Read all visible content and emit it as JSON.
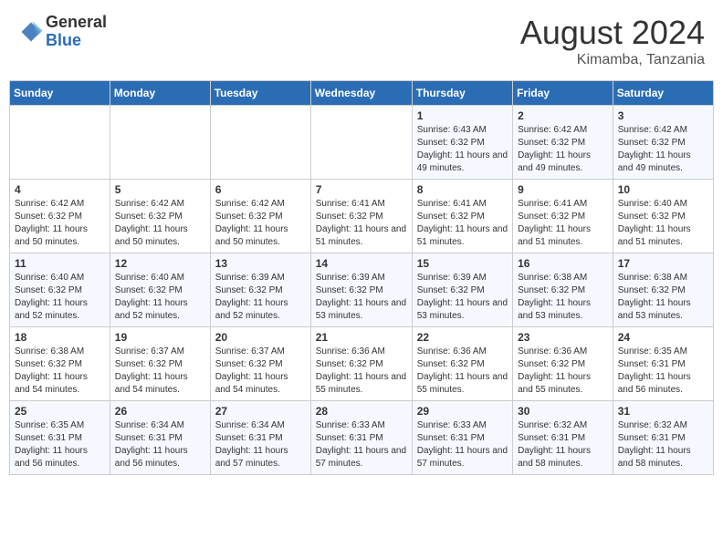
{
  "header": {
    "logo_general": "General",
    "logo_blue": "Blue",
    "month_title": "August 2024",
    "location": "Kimamba, Tanzania"
  },
  "weekdays": [
    "Sunday",
    "Monday",
    "Tuesday",
    "Wednesday",
    "Thursday",
    "Friday",
    "Saturday"
  ],
  "weeks": [
    [
      {
        "day": "",
        "detail": ""
      },
      {
        "day": "",
        "detail": ""
      },
      {
        "day": "",
        "detail": ""
      },
      {
        "day": "",
        "detail": ""
      },
      {
        "day": "1",
        "detail": "Sunrise: 6:43 AM\nSunset: 6:32 PM\nDaylight: 11 hours\nand 49 minutes."
      },
      {
        "day": "2",
        "detail": "Sunrise: 6:42 AM\nSunset: 6:32 PM\nDaylight: 11 hours\nand 49 minutes."
      },
      {
        "day": "3",
        "detail": "Sunrise: 6:42 AM\nSunset: 6:32 PM\nDaylight: 11 hours\nand 49 minutes."
      }
    ],
    [
      {
        "day": "4",
        "detail": "Sunrise: 6:42 AM\nSunset: 6:32 PM\nDaylight: 11 hours\nand 50 minutes."
      },
      {
        "day": "5",
        "detail": "Sunrise: 6:42 AM\nSunset: 6:32 PM\nDaylight: 11 hours\nand 50 minutes."
      },
      {
        "day": "6",
        "detail": "Sunrise: 6:42 AM\nSunset: 6:32 PM\nDaylight: 11 hours\nand 50 minutes."
      },
      {
        "day": "7",
        "detail": "Sunrise: 6:41 AM\nSunset: 6:32 PM\nDaylight: 11 hours\nand 51 minutes."
      },
      {
        "day": "8",
        "detail": "Sunrise: 6:41 AM\nSunset: 6:32 PM\nDaylight: 11 hours\nand 51 minutes."
      },
      {
        "day": "9",
        "detail": "Sunrise: 6:41 AM\nSunset: 6:32 PM\nDaylight: 11 hours\nand 51 minutes."
      },
      {
        "day": "10",
        "detail": "Sunrise: 6:40 AM\nSunset: 6:32 PM\nDaylight: 11 hours\nand 51 minutes."
      }
    ],
    [
      {
        "day": "11",
        "detail": "Sunrise: 6:40 AM\nSunset: 6:32 PM\nDaylight: 11 hours\nand 52 minutes."
      },
      {
        "day": "12",
        "detail": "Sunrise: 6:40 AM\nSunset: 6:32 PM\nDaylight: 11 hours\nand 52 minutes."
      },
      {
        "day": "13",
        "detail": "Sunrise: 6:39 AM\nSunset: 6:32 PM\nDaylight: 11 hours\nand 52 minutes."
      },
      {
        "day": "14",
        "detail": "Sunrise: 6:39 AM\nSunset: 6:32 PM\nDaylight: 11 hours\nand 53 minutes."
      },
      {
        "day": "15",
        "detail": "Sunrise: 6:39 AM\nSunset: 6:32 PM\nDaylight: 11 hours\nand 53 minutes."
      },
      {
        "day": "16",
        "detail": "Sunrise: 6:38 AM\nSunset: 6:32 PM\nDaylight: 11 hours\nand 53 minutes."
      },
      {
        "day": "17",
        "detail": "Sunrise: 6:38 AM\nSunset: 6:32 PM\nDaylight: 11 hours\nand 53 minutes."
      }
    ],
    [
      {
        "day": "18",
        "detail": "Sunrise: 6:38 AM\nSunset: 6:32 PM\nDaylight: 11 hours\nand 54 minutes."
      },
      {
        "day": "19",
        "detail": "Sunrise: 6:37 AM\nSunset: 6:32 PM\nDaylight: 11 hours\nand 54 minutes."
      },
      {
        "day": "20",
        "detail": "Sunrise: 6:37 AM\nSunset: 6:32 PM\nDaylight: 11 hours\nand 54 minutes."
      },
      {
        "day": "21",
        "detail": "Sunrise: 6:36 AM\nSunset: 6:32 PM\nDaylight: 11 hours\nand 55 minutes."
      },
      {
        "day": "22",
        "detail": "Sunrise: 6:36 AM\nSunset: 6:32 PM\nDaylight: 11 hours\nand 55 minutes."
      },
      {
        "day": "23",
        "detail": "Sunrise: 6:36 AM\nSunset: 6:32 PM\nDaylight: 11 hours\nand 55 minutes."
      },
      {
        "day": "24",
        "detail": "Sunrise: 6:35 AM\nSunset: 6:31 PM\nDaylight: 11 hours\nand 56 minutes."
      }
    ],
    [
      {
        "day": "25",
        "detail": "Sunrise: 6:35 AM\nSunset: 6:31 PM\nDaylight: 11 hours\nand 56 minutes."
      },
      {
        "day": "26",
        "detail": "Sunrise: 6:34 AM\nSunset: 6:31 PM\nDaylight: 11 hours\nand 56 minutes."
      },
      {
        "day": "27",
        "detail": "Sunrise: 6:34 AM\nSunset: 6:31 PM\nDaylight: 11 hours\nand 57 minutes."
      },
      {
        "day": "28",
        "detail": "Sunrise: 6:33 AM\nSunset: 6:31 PM\nDaylight: 11 hours\nand 57 minutes."
      },
      {
        "day": "29",
        "detail": "Sunrise: 6:33 AM\nSunset: 6:31 PM\nDaylight: 11 hours\nand 57 minutes."
      },
      {
        "day": "30",
        "detail": "Sunrise: 6:32 AM\nSunset: 6:31 PM\nDaylight: 11 hours\nand 58 minutes."
      },
      {
        "day": "31",
        "detail": "Sunrise: 6:32 AM\nSunset: 6:31 PM\nDaylight: 11 hours\nand 58 minutes."
      }
    ]
  ]
}
